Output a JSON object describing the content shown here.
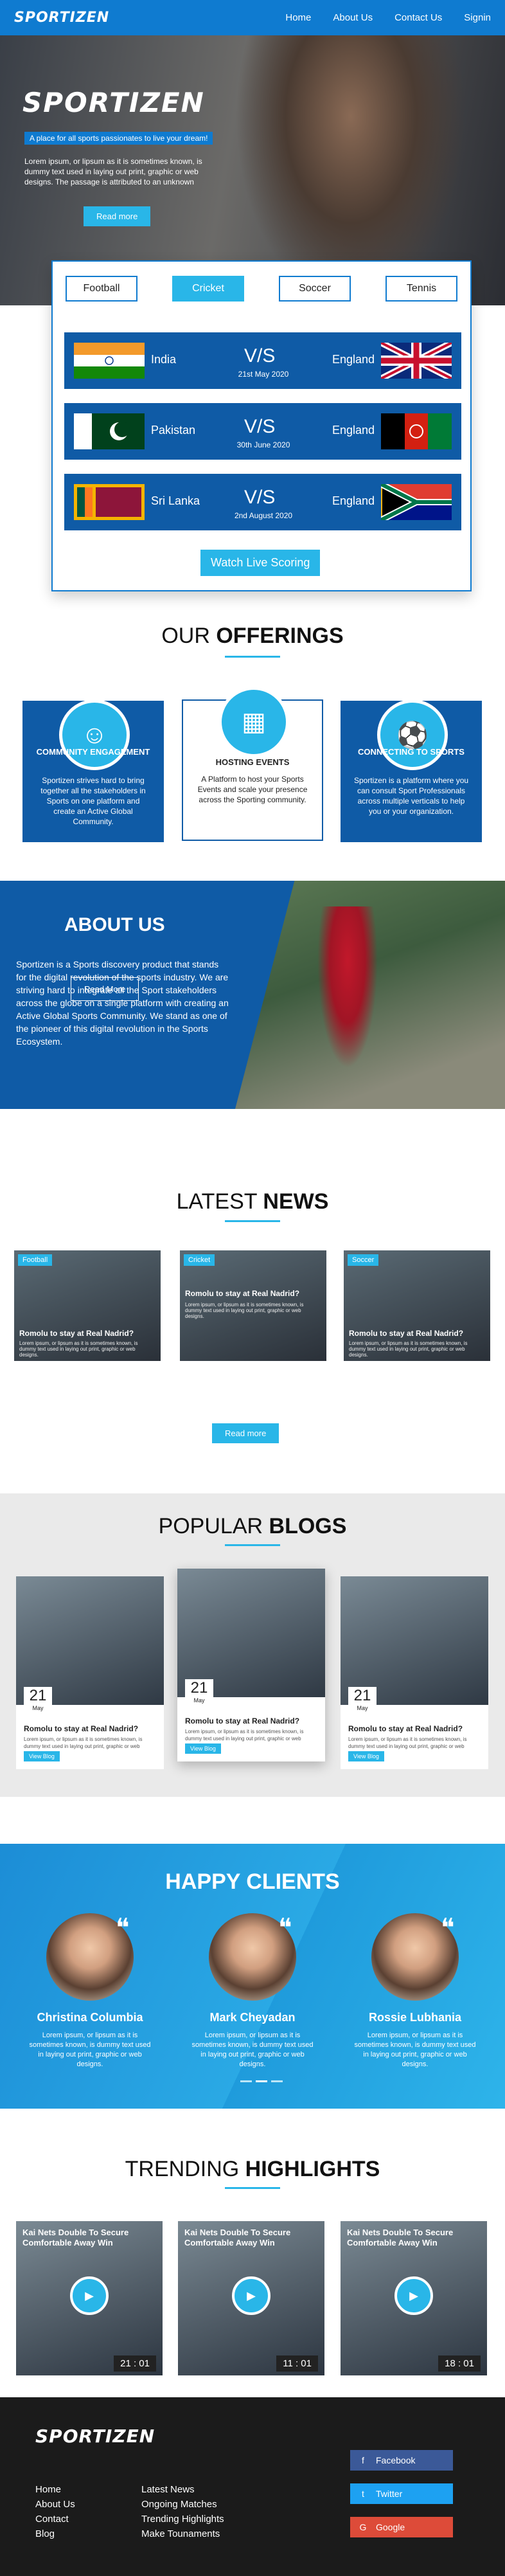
{
  "nav": {
    "logo": "SPORTIZEN",
    "items": [
      "Home",
      "About Us",
      "Contact Us",
      "Signin"
    ]
  },
  "hero": {
    "title": "SPORTIZEN",
    "tagline": "A place for all sports passionates to live your dream!",
    "text": "Lorem ipsum, or lipsum as it is sometimes known, is dummy text used in laying out print, graphic or web designs. The passage is attributed to an unknown",
    "button": "Read more"
  },
  "score": {
    "tabs": [
      "Football",
      "Cricket",
      "Soccer",
      "Tennis"
    ],
    "matches": [
      {
        "t1": "India",
        "vs": "V/S",
        "date": "21st May 2020",
        "t2": "England"
      },
      {
        "t1": "Pakistan",
        "vs": "V/S",
        "date": "30th June 2020",
        "t2": "England"
      },
      {
        "t1": "Sri Lanka",
        "vs": "V/S",
        "date": "2nd August 2020",
        "t2": "England"
      }
    ],
    "button": "Watch Live Scoring"
  },
  "offerings": {
    "title_a": "OUR ",
    "title_b": "OFFERINGS",
    "items": [
      {
        "h": "COMMUNITY ENGAGEMENT",
        "p": "Sportizen strives hard to bring together all the stakeholders in Sports on one platform and create an Active Global Community."
      },
      {
        "h": "HOSTING EVENTS",
        "p": "A Platform to host your Sports Events and scale your presence across the Sporting community."
      },
      {
        "h": "CONNECTING TO SPORTS",
        "p": "Sportizen is a platform where you can consult Sport Professionals across multiple verticals to help you or your organization."
      }
    ]
  },
  "about": {
    "title_a": "ABOUT ",
    "title_b": "US",
    "text": "Sportizen is a Sports discovery product that stands for the digital revolution of the sports industry. We are striving hard to integrate all the Sport stakeholders across the globe on a single platform with creating an Active Global Sports Community. We stand as one of the pioneer of this digital revolution in the Sports Ecosystem.",
    "button": "Read More"
  },
  "news": {
    "title_a": "LATEST ",
    "title_b": "NEWS",
    "items": [
      {
        "lbl": "Football",
        "h": "Romolu to stay at Real Nadrid?",
        "meta": "Lorem ipsum, or lipsum as it is sometimes known, is dummy text used in laying out print, graphic or web designs."
      },
      {
        "lbl": "Cricket",
        "h": "Romolu to stay at Real Nadrid?",
        "meta": "Lorem ipsum, or lipsum as it is sometimes known, is dummy text used in laying out print, graphic or web designs."
      },
      {
        "lbl": "Soccer",
        "h": "Romolu to stay at Real Nadrid?",
        "meta": "Lorem ipsum, or lipsum as it is sometimes known, is dummy text used in laying out print, graphic or web designs."
      }
    ],
    "button": "Read more"
  },
  "blogs": {
    "title_a": "POPULAR ",
    "title_b": "BLOGS",
    "items": [
      {
        "d": "21",
        "m": "May",
        "h": "Romolu to stay at Real Nadrid?",
        "p": "Lorem ipsum, or lipsum as it is sometimes known, is dummy text used in laying out print, graphic or web designs.",
        "b": "View Blog"
      },
      {
        "d": "21",
        "m": "May",
        "h": "Romolu to stay at Real Nadrid?",
        "p": "Lorem ipsum, or lipsum as it is sometimes known, is dummy text used in laying out print, graphic or web designs.",
        "b": "View Blog"
      },
      {
        "d": "21",
        "m": "May",
        "h": "Romolu to stay at Real Nadrid?",
        "p": "Lorem ipsum, or lipsum as it is sometimes known, is dummy text used in laying out print, graphic or web designs.",
        "b": "View Blog"
      }
    ]
  },
  "clients": {
    "title_a": "HAPPY ",
    "title_b": "CLIENTS",
    "items": [
      {
        "n": "Christina Columbia",
        "p": "Lorem ipsum, or lipsum as it is sometimes known, is dummy text used in laying out print, graphic or web designs."
      },
      {
        "n": "Mark Cheyadan",
        "p": "Lorem ipsum, or lipsum as it is sometimes known, is dummy text used in laying out print, graphic or web designs."
      },
      {
        "n": "Rossie Lubhania",
        "p": "Lorem ipsum, or lipsum as it is sometimes known, is dummy text used in laying out print, graphic or web designs."
      }
    ]
  },
  "highlights": {
    "title_a": "TRENDING ",
    "title_b": "HIGHLIGHTS",
    "items": [
      {
        "h": "Kai Nets Double To Secure Comfortable Away Win",
        "t": "21 : 01"
      },
      {
        "h": "Kai Nets Double To Secure Comfortable Away Win",
        "t": "11 : 01"
      },
      {
        "h": "Kai Nets Double To Secure Comfortable Away Win",
        "t": "18 : 01"
      }
    ]
  },
  "footer": {
    "logo": "SPORTIZEN",
    "col1": [
      "Home",
      "About Us",
      "Contact",
      "Blog"
    ],
    "col2": [
      "Latest News",
      "Ongoing Matches",
      "Trending Highlights",
      "Make Tounaments"
    ],
    "social": [
      {
        "n": "Facebook",
        "c": "#3b5998",
        "i": "f"
      },
      {
        "n": "Twitter",
        "c": "#1da1f2",
        "i": "t"
      },
      {
        "n": "Google",
        "c": "#dd4b39",
        "i": "G"
      }
    ]
  }
}
